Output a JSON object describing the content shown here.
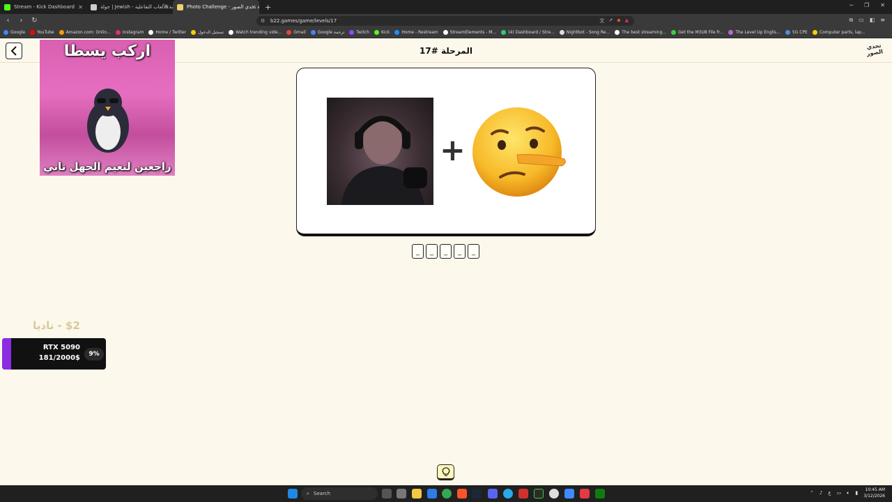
{
  "browser": {
    "tabs": [
      {
        "title": "Stream - Kick Dashboard",
        "color": "#53fc18"
      },
      {
        "title": "جولة | Jewish - منصة الألعاب التفاعلية",
        "color": "#cccccc"
      },
      {
        "title": "Photo Challenge - لعبة تحدي الصور",
        "color": "#f0d070",
        "active": true
      }
    ],
    "url": "b22.games/game/levels/17",
    "bookmarks": [
      {
        "label": "Google",
        "color": "#4285f4"
      },
      {
        "label": "YouTube",
        "color": "#ff0000"
      },
      {
        "label": "Amazon.com: Onlin...",
        "color": "#ff9900"
      },
      {
        "label": "Instagram",
        "color": "#e1306c"
      },
      {
        "label": "Home / Twitter",
        "color": "#ffffff"
      },
      {
        "label": "تسجيل الدخول",
        "color": "#ffcc00"
      },
      {
        "label": "Watch trending vide...",
        "color": "#ffffff"
      },
      {
        "label": "Gmail",
        "color": "#ea4335"
      },
      {
        "label": "Google ترجمة",
        "color": "#4285f4"
      },
      {
        "label": "Twitch",
        "color": "#9146ff"
      },
      {
        "label": "Kick",
        "color": "#53fc18"
      },
      {
        "label": "Home - Restream",
        "color": "#1e90ff"
      },
      {
        "label": "StreamElements - M...",
        "color": "#ffffff"
      },
      {
        "label": "(4) Dashboard / Stre...",
        "color": "#2ecc71"
      },
      {
        "label": "Nightbot - Song Re...",
        "color": "#dddddd"
      },
      {
        "label": "The best streaming...",
        "color": "#ffffff"
      },
      {
        "label": "Get the M3U8 File fr...",
        "color": "#3ccf3c"
      },
      {
        "label": "The Level Up Englis...",
        "color": "#b36ad1"
      },
      {
        "label": "5G CPE",
        "color": "#4a90e2"
      },
      {
        "label": "Computer parts, lap...",
        "color": "#ffcc00"
      }
    ]
  },
  "game": {
    "level_title": "المرحلة #17",
    "logo_text": "تحدي الصور",
    "plus_symbol": "+",
    "answer_slots": [
      "_",
      "_",
      "_",
      "_",
      "_"
    ]
  },
  "overlay": {
    "meme_top": "اركب يسطا",
    "meme_bottom": "راجعين لنعيم الجهل تاني",
    "donor": "$2 - ناديا",
    "goal_name": "RTX 5090",
    "goal_amount": "181/2000$",
    "goal_percent_label": "9%",
    "goal_fraction": 0.09
  },
  "taskbar": {
    "search_label": "Search",
    "time": "10:45 AM",
    "date": "3/12/2026"
  }
}
